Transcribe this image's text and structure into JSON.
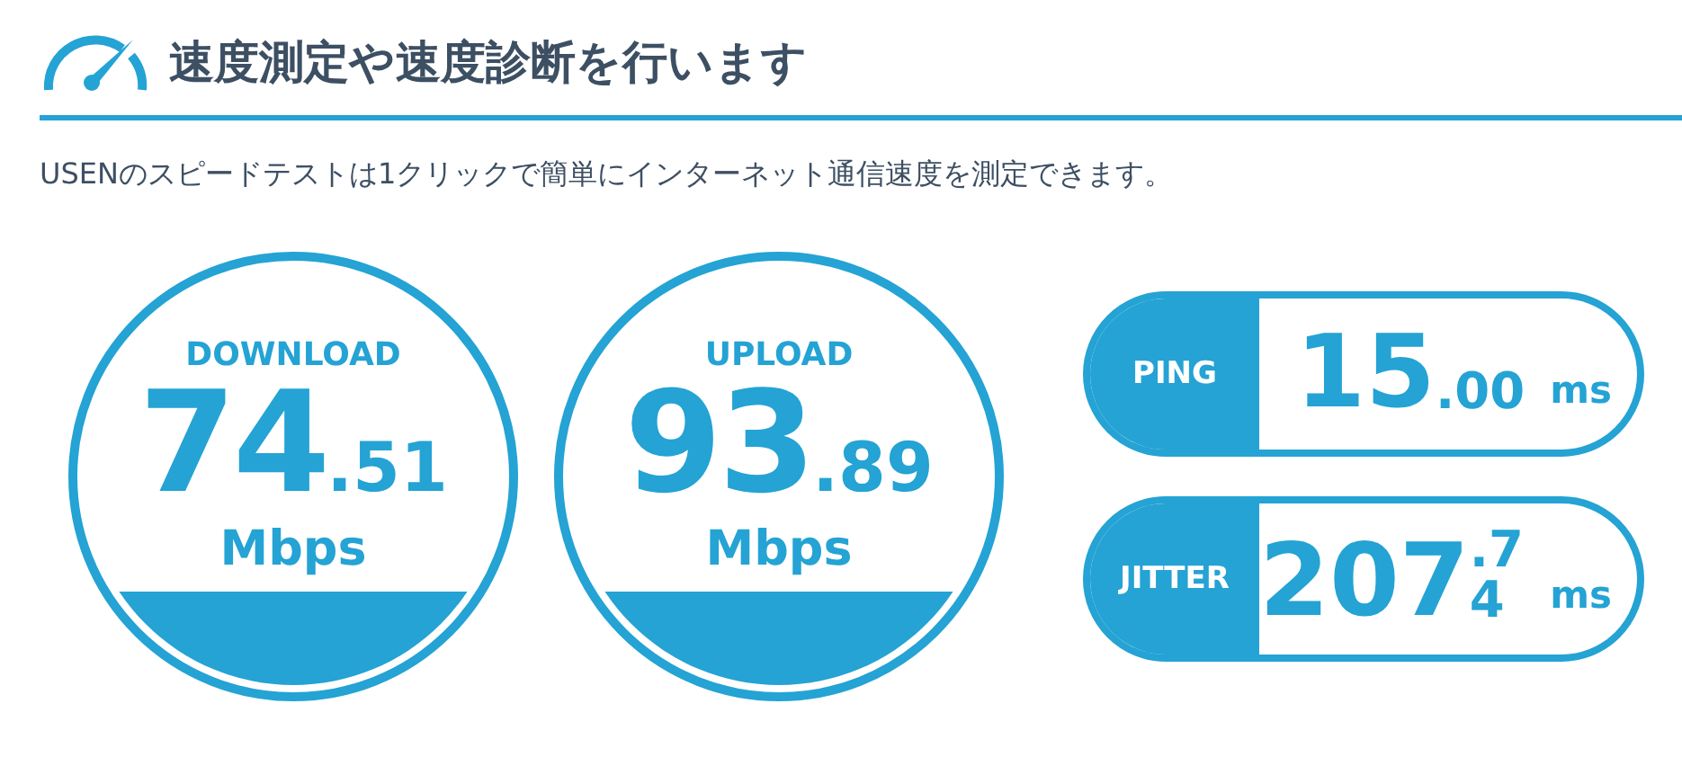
{
  "header": {
    "title": "速度測定や速度診断を行います"
  },
  "description": "USENのスピードテストは1クリックで簡単にインターネット通信速度を測定できます。",
  "gauges": [
    {
      "label": "DOWNLOAD",
      "integer": "74",
      "decimal": ".51",
      "unit": "Mbps"
    },
    {
      "label": "UPLOAD",
      "integer": "93",
      "decimal": ".89",
      "unit": "Mbps"
    }
  ],
  "metrics": [
    {
      "label": "PING",
      "integer": "15",
      "decimal": ".00",
      "unit": "ms"
    },
    {
      "label": "JITTER",
      "integer": "207",
      "decimal": ".74",
      "unit": "ms"
    }
  ]
}
